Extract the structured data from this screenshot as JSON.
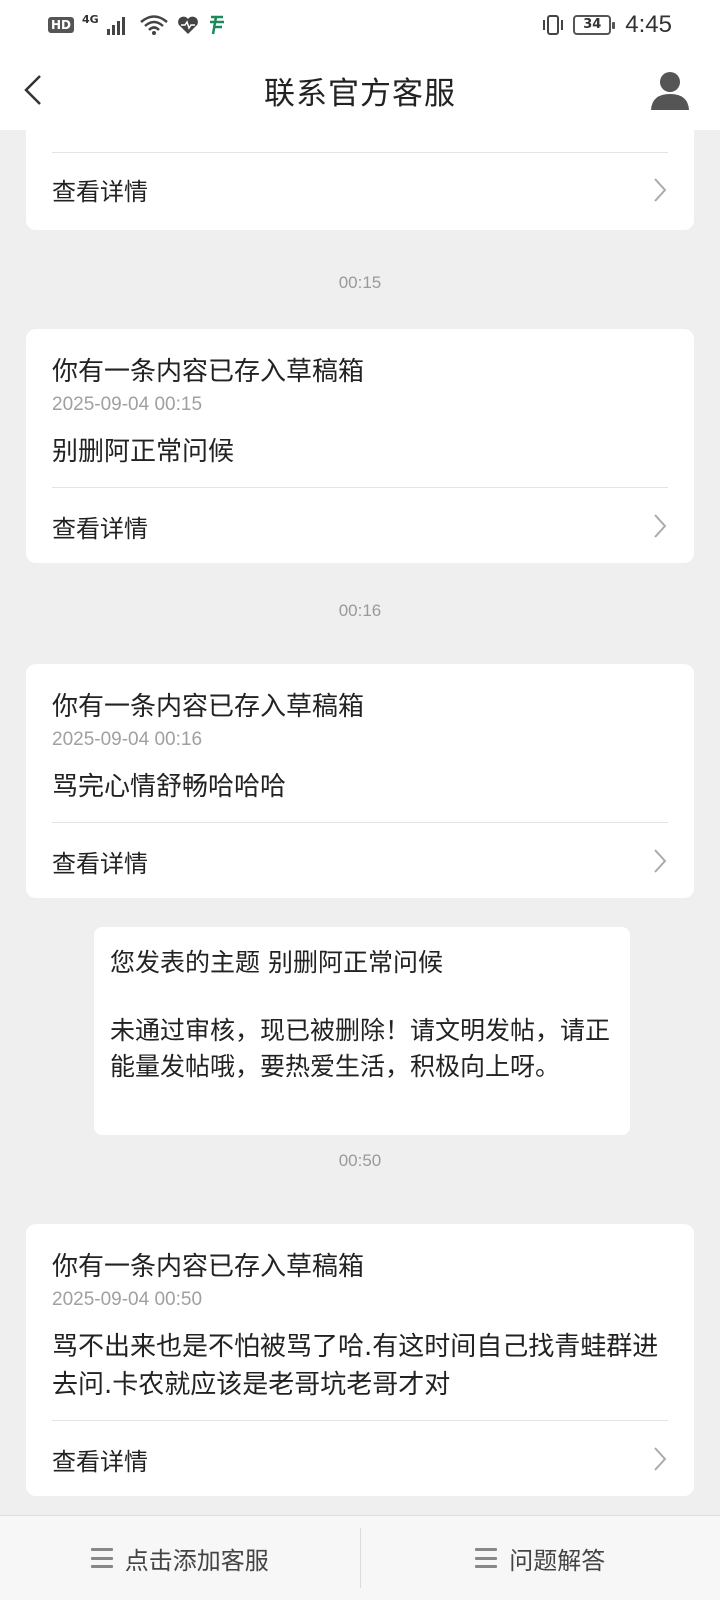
{
  "status_bar": {
    "hd": "HD",
    "network": "4G",
    "battery": "34",
    "time": "4:45"
  },
  "nav": {
    "title": "联系官方客服",
    "back_icon": "chevron-left-icon",
    "user_icon": "user-icon"
  },
  "feed": {
    "partial_card": {
      "link": "查看详情"
    },
    "timestamp_1": "00:15",
    "card_1": {
      "title": "你有一条内容已存入草稿箱",
      "date": "2025-09-04 00:15",
      "body": "别删阿正常问候",
      "link": "查看详情"
    },
    "timestamp_2": "00:16",
    "card_2": {
      "title": "你有一条内容已存入草稿箱",
      "date": "2025-09-04 00:16",
      "body": "骂完心情舒畅哈哈哈",
      "link": "查看详情"
    },
    "system_message": {
      "line1": "您发表的主题 别删阿正常问候",
      "line2": "未通过审核，现已被删除！请文明发帖，请正能量发帖哦，要热爱生活，积极向上呀。"
    },
    "timestamp_3": "00:50",
    "card_3": {
      "title": "你有一条内容已存入草稿箱",
      "date": "2025-09-04 00:50",
      "body": "骂不出来也是不怕被骂了哈.有这时间自己找青蛙群进去问.卡农就应该是老哥坑老哥才对",
      "link": "查看详情"
    }
  },
  "bottom_bar": {
    "left_label": "点击添加客服",
    "right_label": "问题解答"
  },
  "colors": {
    "background": "#efefef",
    "card": "#ffffff",
    "muted_text": "#a0a0a0"
  }
}
